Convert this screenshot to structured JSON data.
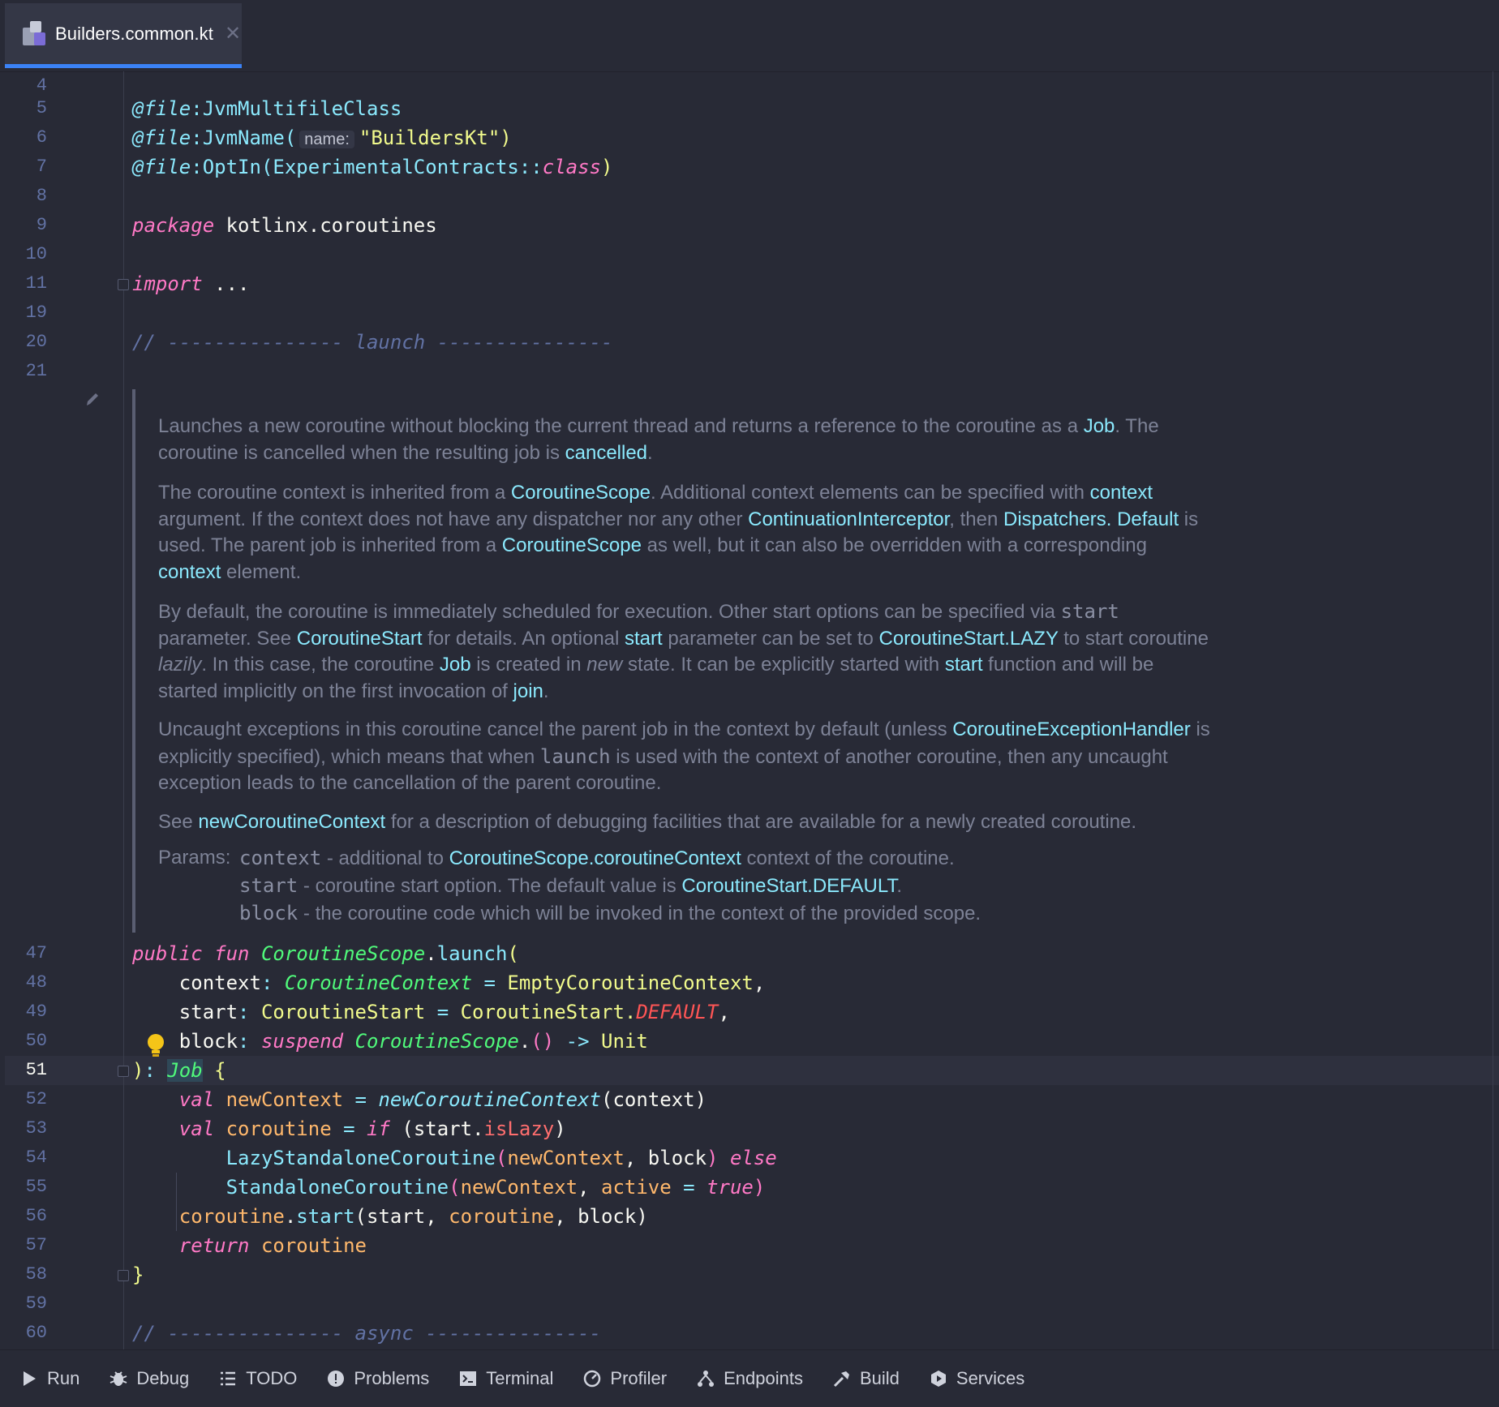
{
  "tab": {
    "title": "Builders.common.kt",
    "close": "✕"
  },
  "line_numbers": [
    "4",
    "5",
    "6",
    "7",
    "8",
    "9",
    "10",
    "11",
    "19",
    "20",
    "21",
    "47",
    "48",
    "49",
    "50",
    "51",
    "52",
    "53",
    "54",
    "55",
    "56",
    "57",
    "58",
    "59",
    "60"
  ],
  "code": {
    "l5_ann": "@file",
    "l5_name": ":JvmMultifileClass",
    "l6_ann": "@file",
    "l6_name": ":JvmName(",
    "l6_hint": "name:",
    "l6_str": "\"BuildersKt\"",
    "l6_end": ")",
    "l7_ann": "@file",
    "l7_name": ":OptIn(",
    "l7_cls": "ExperimentalContracts",
    "l7_sep": "::",
    "l7_kw": "class",
    "l7_end": ")",
    "l9_kw": "package",
    "l9_pkg": " kotlinx.coroutines",
    "l11_kw": "import",
    "l11_rest": " ...",
    "l20_cmt": "// --------------- launch ---------------",
    "l47_kw1": "public",
    "l47_kw2": "fun",
    "l47_type": "CoroutineScope",
    "l47_dot": ".",
    "l47_fn": "launch",
    "l47_paren": "(",
    "l48_p": "context",
    "l48_col": ": ",
    "l48_type": "CoroutineContext",
    "l48_eq": " = ",
    "l48_val": "EmptyCoroutineContext",
    "l48_end": ",",
    "l49_p": "start",
    "l49_col": ": ",
    "l49_type": "CoroutineStart",
    "l49_eq": " = ",
    "l49_cls": "CoroutineStart.",
    "l49_const": "DEFAULT",
    "l49_end": ",",
    "l50_p": "block",
    "l50_col": ": ",
    "l50_kw": "suspend",
    "l50_type": "CoroutineScope",
    "l50_dot": ".",
    "l50_paren": "()",
    "l50_arrow": " -> ",
    "l50_unit": "Unit",
    "l51_paren": ")",
    "l51_col": ": ",
    "l51_type": "Job",
    "l51_brace": " {",
    "l52_kw": "val",
    "l52_var": " newContext",
    "l52_eq": " = ",
    "l52_fn": "newCoroutineContext",
    "l52_args": "(context)",
    "l53_kw": "val",
    "l53_var": " coroutine",
    "l53_eq": " = ",
    "l53_if": "if",
    "l53_a": " (start.",
    "l53_prop": "isLazy",
    "l53_b": ")",
    "l54_fn": "LazyStandaloneCoroutine",
    "l54_p1": "(",
    "l54_a1": "newContext",
    "l54_sep": ", block",
    "l54_p2": ")",
    "l54_kw": " else",
    "l55_fn": "StandaloneCoroutine",
    "l55_p1": "(",
    "l55_a1": "newContext",
    "l55_sep": ", ",
    "l55_a2": "active",
    "l55_eq": " = ",
    "l55_kw": "true",
    "l55_p2": ")",
    "l56_var": "coroutine",
    "l56_dot": ".",
    "l56_fn": "start",
    "l56_a": "(start, ",
    "l56_b": "coroutine",
    "l56_c": ", block)",
    "l57_kw": "return",
    "l57_var": " coroutine",
    "l58_brace": "}",
    "l60_cmt": "// --------------- async ---------------"
  },
  "doc": {
    "p1": [
      "Launches a new coroutine without blocking the current thread and returns a reference to the coroutine as a ",
      "Job",
      ". The coroutine is cancelled when the resulting job is ",
      "cancelled",
      "."
    ],
    "p2": [
      "The coroutine context is inherited from a ",
      "CoroutineScope",
      ". Additional context elements can be specified with ",
      "context",
      " argument. If the context does not have any dispatcher nor any other ",
      "ContinuationInterceptor",
      ", then ",
      "Dispatchers.",
      "Default",
      " is used. The parent job is inherited from a ",
      "CoroutineScope",
      " as well, but it can also be overridden with a corresponding ",
      "context",
      " element."
    ],
    "p3": [
      "By default, the coroutine is immediately scheduled for execution. Other start options can be specified via ",
      "start",
      " parameter. See ",
      "CoroutineStart",
      " for details. An optional ",
      "start",
      " parameter can be set to ",
      "CoroutineStart.LAZY",
      " to start coroutine ",
      "lazily",
      ". In this case, the coroutine ",
      "Job",
      " is created in ",
      "new",
      " state. It can be explicitly started with ",
      "start",
      " function and will be started implicitly on the first invocation of ",
      "join",
      "."
    ],
    "p4": [
      "Uncaught exceptions in this coroutine cancel the parent job in the context by default (unless ",
      "CoroutineExceptionHandler",
      " is explicitly specified), which means that when ",
      "launch",
      " is used with the context of another coroutine, then any uncaught exception leads to the cancellation of the parent coroutine."
    ],
    "p5": [
      "See ",
      "newCoroutineContext",
      " for a description of debugging facilities that are available for a newly created coroutine."
    ],
    "params_label": "Params:",
    "param1": [
      "context",
      " - additional to ",
      "CoroutineScope.coroutineContext",
      " context of the coroutine."
    ],
    "param2": [
      "start",
      " - coroutine start option. The default value is ",
      "CoroutineStart.DEFAULT",
      "."
    ],
    "param3": [
      "block",
      " - the coroutine code which will be invoked in the context of the provided scope."
    ]
  },
  "statusbar": [
    {
      "label": "Run",
      "icon": "run-icon"
    },
    {
      "label": "Debug",
      "icon": "debug-icon"
    },
    {
      "label": "TODO",
      "icon": "todo-icon"
    },
    {
      "label": "Problems",
      "icon": "problems-icon"
    },
    {
      "label": "Terminal",
      "icon": "terminal-icon"
    },
    {
      "label": "Profiler",
      "icon": "profiler-icon"
    },
    {
      "label": "Endpoints",
      "icon": "endpoints-icon"
    },
    {
      "label": "Build",
      "icon": "build-icon"
    },
    {
      "label": "Services",
      "icon": "services-icon"
    }
  ],
  "colors": {
    "background": "#282a36",
    "link": "#8be9fd",
    "keyword": "#ff79c6",
    "tab_accent": "#3b82f6"
  }
}
